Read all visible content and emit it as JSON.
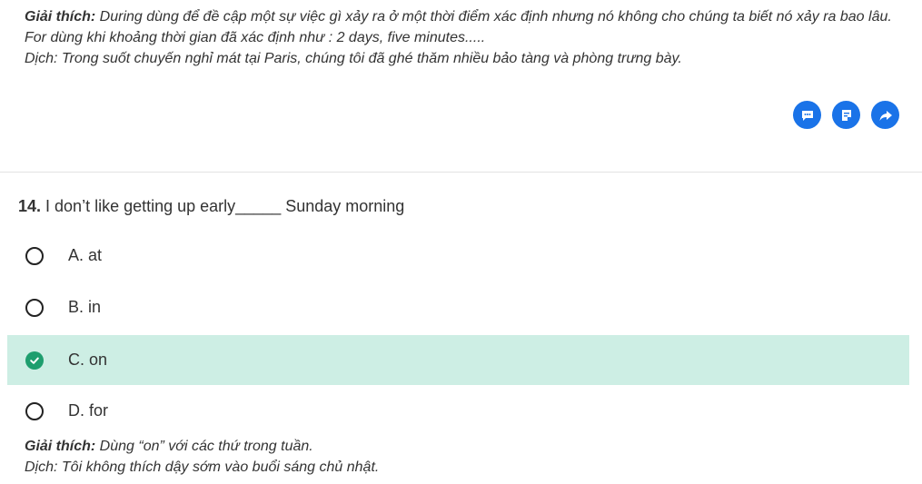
{
  "prev_explanation": {
    "label": "Giải thích:",
    "text": " During dùng để đề cập một sự việc gì xảy ra ở một thời điểm xác định nhưng nó không cho chúng ta biết nó xảy ra bao lâu.",
    "line2": "For dùng khi khoảng thời gian đã xác định như : 2 days, five minutes.....",
    "line3": "Dịch: Trong suốt chuyến nghỉ mát tại Paris, chúng tôi đã ghé thăm nhiều bảo tàng và phòng trưng bày."
  },
  "actions": [
    {
      "icon": "comment-icon"
    },
    {
      "icon": "note-icon"
    },
    {
      "icon": "share-icon"
    }
  ],
  "question": {
    "number": "14.",
    "text": " I don’t like getting up early_____ Sunday morning"
  },
  "options": [
    {
      "label": "A. at",
      "correct": false
    },
    {
      "label": "B. in",
      "correct": false
    },
    {
      "label": "C. on",
      "correct": true
    },
    {
      "label": "D. for",
      "correct": false
    }
  ],
  "explanation": {
    "label": "Giải thích:",
    "text": " Dùng “on” với các thứ trong tuần.",
    "translation": "Dịch: Tôi không thích dậy sớm vào buổi sáng chủ nhật."
  },
  "colors": {
    "action_button": "#1a73e8",
    "correct_bg": "#cdeee4",
    "correct_check": "#1e9e6e"
  }
}
